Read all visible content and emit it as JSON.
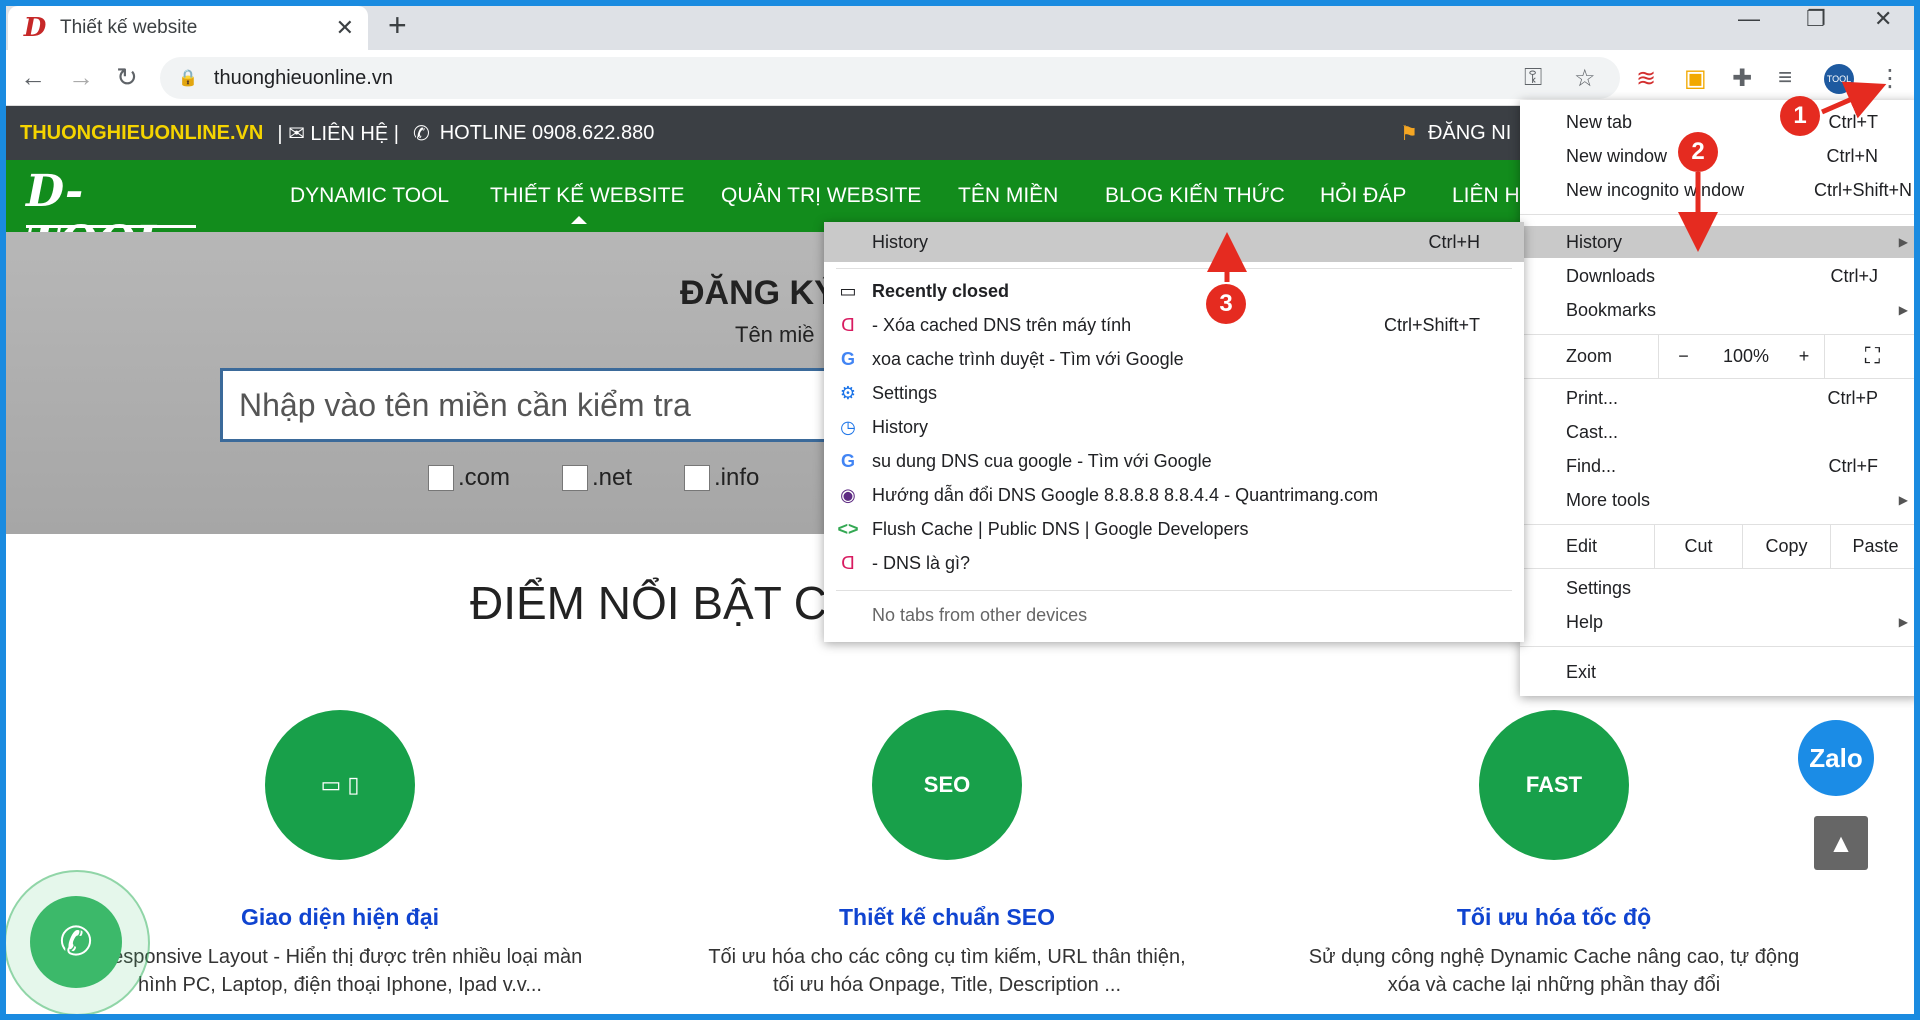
{
  "browser": {
    "tab_title": "Thiết kế website",
    "url": "thuonghieuonline.vn"
  },
  "site": {
    "brand": "THUONGHIEUONLINE.VN",
    "contact": "| ✉ LIÊN HỆ |",
    "hotline": "HOTLINE 0908.622.880",
    "register": "ĐĂNG NI",
    "logo": "D-TOOL",
    "nav": [
      "DYNAMIC TOOL",
      "THIẾT KẾ WEBSITE",
      "QUẢN TRỊ WEBSITE",
      "TÊN MIỀN",
      "BLOG KIẾN THỨC",
      "HỎI ĐÁP",
      "LIÊN H"
    ],
    "hero_title": "ĐĂNG KÝ",
    "hero_sub": "Tên miề",
    "search_placeholder": "Nhập vào tên miền cần kiểm tra",
    "domains": [
      ".com",
      ".net",
      ".info"
    ],
    "section_title": "ĐIỂM NỔI BẬT CỦ",
    "features": [
      {
        "title": "Giao diện hiện đại",
        "desc": "Responsive Layout - Hiển thị được trên nhiều loại màn hình PC, Laptop, điện thoại Iphone, Ipad v.v...",
        "icon": "devices-icon",
        "badge": ""
      },
      {
        "title": "Thiết kế chuẩn SEO",
        "desc": "Tối ưu hóa cho các công cụ tìm kiếm, URL thân thiện, tối ưu hóa Onpage, Title, Description ...",
        "icon": "seo-icon",
        "badge": "SEO"
      },
      {
        "title": "Tối ưu hóa tốc độ",
        "desc": "Sử dụng công nghệ Dynamic Cache nâng cao, tự động xóa và cache lại những phần thay đổi",
        "icon": "speedometer-icon",
        "badge": "FAST"
      }
    ],
    "zalo": "Zalo"
  },
  "menu": {
    "new_tab": "New tab",
    "new_tab_sc": "Ctrl+T",
    "new_window": "New window",
    "new_window_sc": "Ctrl+N",
    "new_incognito": "New incognito window",
    "new_incognito_sc": "Ctrl+Shift+N",
    "history": "History",
    "downloads": "Downloads",
    "downloads_sc": "Ctrl+J",
    "bookmarks": "Bookmarks",
    "zoom": "Zoom",
    "zoom_minus": "−",
    "zoom_value": "100%",
    "zoom_plus": "+",
    "print": "Print...",
    "print_sc": "Ctrl+P",
    "cast": "Cast...",
    "find": "Find...",
    "find_sc": "Ctrl+F",
    "more_tools": "More tools",
    "edit": "Edit",
    "cut": "Cut",
    "copy": "Copy",
    "paste": "Paste",
    "settings": "Settings",
    "help": "Help",
    "exit": "Exit"
  },
  "history_menu": {
    "header": "History",
    "header_sc": "Ctrl+H",
    "recently_closed": "Recently closed",
    "items": [
      {
        "label": "- Xóa cached DNS trên máy tính",
        "sc": "Ctrl+Shift+T",
        "icon": "site-favicon-icon"
      },
      {
        "label": "xoa cache trình duyệt - Tìm với Google",
        "sc": "",
        "icon": "google-icon"
      },
      {
        "label": "Settings",
        "sc": "",
        "icon": "settings-icon"
      },
      {
        "label": "History",
        "sc": "",
        "icon": "history-icon"
      },
      {
        "label": "su dung DNS cua google - Tìm với Google",
        "sc": "",
        "icon": "google-icon"
      },
      {
        "label": "Hướng dẫn đổi DNS Google 8.8.8.8 8.8.4.4 - Quantrimang.com",
        "sc": "",
        "icon": "quantrimang-icon"
      },
      {
        "label": "Flush Cache  |  Public DNS  |  Google Developers",
        "sc": "",
        "icon": "google-dev-icon"
      },
      {
        "label": "- DNS là gì?",
        "sc": "",
        "icon": "site-favicon-icon"
      }
    ],
    "no_tabs": "No tabs from other devices"
  },
  "callouts": [
    "1",
    "2",
    "3"
  ],
  "colors": {
    "accent_green": "#128c1c",
    "callout_red": "#e52b20",
    "frame_blue": "#1a8be0"
  }
}
